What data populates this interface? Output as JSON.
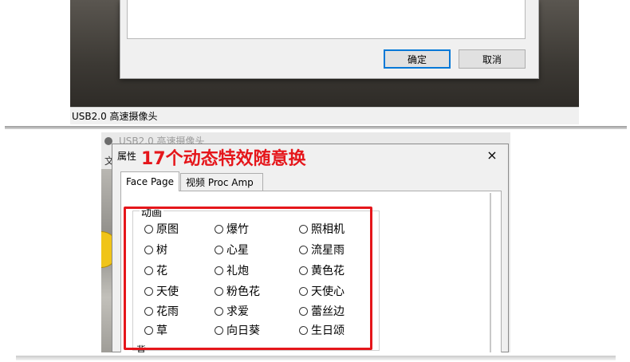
{
  "top_window": {
    "status_text": "USB2.0 高速摄像头",
    "ok_label": "确定",
    "cancel_label": "取消"
  },
  "bottom_window": {
    "bg_title": "USB2.0 高速摄像头",
    "bg_menu": "文",
    "dialog_title": "属性",
    "annotation": "17个动态特效随意换",
    "close_icon": "×",
    "tabs": [
      {
        "label": "Face Page",
        "active": true
      },
      {
        "label": "视频 Proc Amp",
        "active": false
      }
    ],
    "group_label": "动画",
    "options": [
      [
        "原图",
        "爆竹",
        "照相机"
      ],
      [
        "树",
        "心星",
        "流星雨"
      ],
      [
        "花",
        "礼炮",
        "黄色花"
      ],
      [
        "天使",
        "粉色花",
        "天使心"
      ],
      [
        "花雨",
        "求爱",
        "蕾丝边"
      ],
      [
        "草",
        "向日葵",
        "生日颂"
      ]
    ],
    "cut_label": "背"
  },
  "colors": {
    "annotation": "#e5161b",
    "highlight_box": "#e5161b",
    "ok_button_border": "#0078d7"
  }
}
